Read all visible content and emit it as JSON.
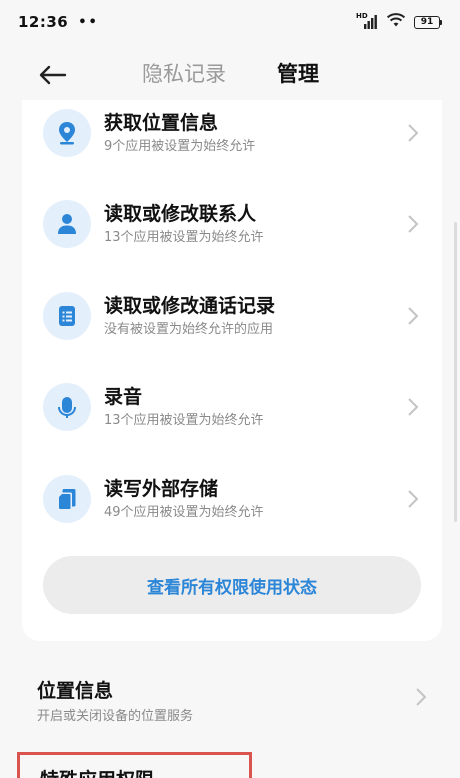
{
  "status_bar": {
    "time": "12:36",
    "dots": "••",
    "hd_label": "HD",
    "battery": "91"
  },
  "header": {
    "tab_inactive": "隐私记录",
    "tab_active": "管理"
  },
  "permissions": [
    {
      "title": "获取位置信息",
      "subtitle": "9个应用被设置为始终允许",
      "icon": "location-pin-icon"
    },
    {
      "title": "读取或修改联系人",
      "subtitle": "13个应用被设置为始终允许",
      "icon": "person-icon"
    },
    {
      "title": "读取或修改通话记录",
      "subtitle": "没有被设置为始终允许的应用",
      "icon": "call-log-icon"
    },
    {
      "title": "录音",
      "subtitle": "13个应用被设置为始终允许",
      "icon": "microphone-icon"
    },
    {
      "title": "读写外部存储",
      "subtitle": "49个应用被设置为始终允许",
      "icon": "storage-icon"
    }
  ],
  "view_all_button": "查看所有权限使用状态",
  "location_setting": {
    "title": "位置信息",
    "subtitle": "开启或关闭设备的位置服务"
  },
  "special_permission": {
    "title": "特殊应用权限"
  },
  "colors": {
    "accent": "#2c86d8",
    "icon_bg": "#e3effb",
    "highlight_border": "#d9534f"
  }
}
